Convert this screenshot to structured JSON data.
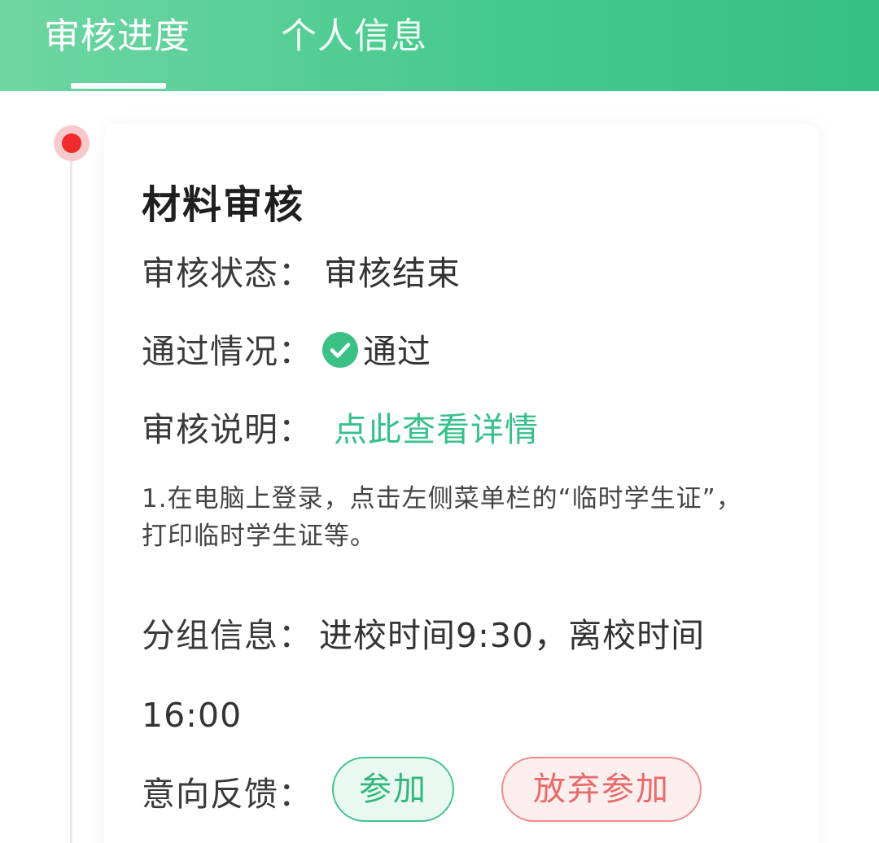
{
  "header": {
    "tabs": [
      {
        "label": "审核进度",
        "active": true
      },
      {
        "label": "个人信息",
        "active": false
      }
    ]
  },
  "card": {
    "title": "材料审核",
    "status": {
      "label": "审核状态：",
      "value": "审核结束"
    },
    "pass": {
      "label": "通过情况：",
      "value": "通过",
      "icon": "check-circle-icon",
      "icon_color": "#3cc184"
    },
    "explain": {
      "label": "审核说明：",
      "link": "点此查看详情",
      "link_color": "#36c08a"
    },
    "note": "1.在电脑上登录，点击左侧菜单栏的“临时学生证”，打印临时学生证等。",
    "group": {
      "label": "分组信息：",
      "value": "进校时间9:30，离校时间16:00"
    },
    "feedback": {
      "label": "意向反馈：",
      "join_label": "参加",
      "giveup_label": "放弃参加"
    }
  },
  "colors": {
    "header_start": "#6fd6a2",
    "header_end": "#37c083",
    "timeline_dot": "#ef2b2b",
    "join_border": "#42c48c",
    "giveup_border": "#f08c8c"
  }
}
